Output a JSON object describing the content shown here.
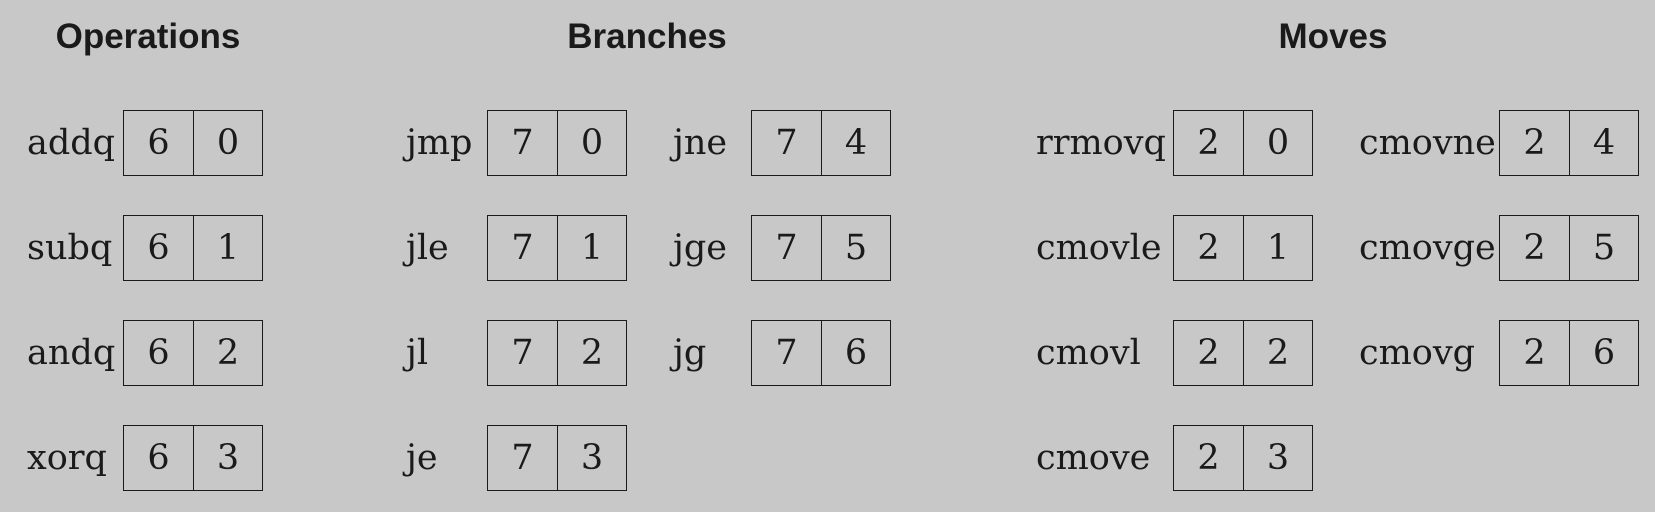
{
  "headings": {
    "operations": "Operations",
    "branches": "Branches",
    "moves": "Moves"
  },
  "operations": [
    {
      "mnemonic": "addq",
      "hi": "6",
      "lo": "0"
    },
    {
      "mnemonic": "subq",
      "hi": "6",
      "lo": "1"
    },
    {
      "mnemonic": "andq",
      "hi": "6",
      "lo": "2"
    },
    {
      "mnemonic": "xorq",
      "hi": "6",
      "lo": "3"
    }
  ],
  "branches": [
    {
      "mnemonic": "jmp",
      "hi": "7",
      "lo": "0"
    },
    {
      "mnemonic": "jle",
      "hi": "7",
      "lo": "1"
    },
    {
      "mnemonic": "jl",
      "hi": "7",
      "lo": "2"
    },
    {
      "mnemonic": "je",
      "hi": "7",
      "lo": "3"
    },
    {
      "mnemonic": "jne",
      "hi": "7",
      "lo": "4"
    },
    {
      "mnemonic": "jge",
      "hi": "7",
      "lo": "5"
    },
    {
      "mnemonic": "jg",
      "hi": "7",
      "lo": "6"
    }
  ],
  "moves": [
    {
      "mnemonic": "rrmovq",
      "hi": "2",
      "lo": "0"
    },
    {
      "mnemonic": "cmovle",
      "hi": "2",
      "lo": "1"
    },
    {
      "mnemonic": "cmovl",
      "hi": "2",
      "lo": "2"
    },
    {
      "mnemonic": "cmove",
      "hi": "2",
      "lo": "3"
    },
    {
      "mnemonic": "cmovne",
      "hi": "2",
      "lo": "4"
    },
    {
      "mnemonic": "cmovge",
      "hi": "2",
      "lo": "5"
    },
    {
      "mnemonic": "cmovg",
      "hi": "2",
      "lo": "6"
    }
  ]
}
